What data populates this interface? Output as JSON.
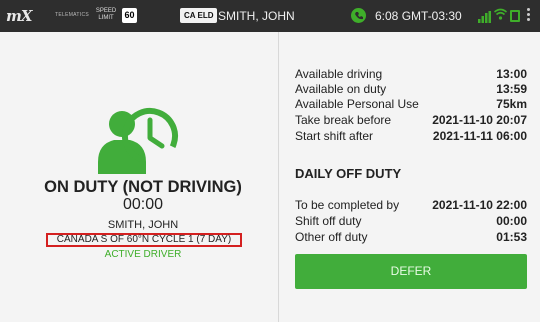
{
  "topbar": {
    "logo": "mX",
    "logo_sub": "TELEMATICS",
    "speed_limit_label": "SPEED LIMIT",
    "speed_limit_value": "60",
    "eld_badge": "CA ELD",
    "driver": "SMITH, JOHN",
    "time": "6:08 GMT-03:30",
    "colors": {
      "background": "#2e2e2e",
      "accent": "#3fae2a"
    },
    "icons": [
      "status-icon",
      "signal-icon",
      "wifi-icon",
      "document-icon",
      "overflow-menu-icon"
    ]
  },
  "status": {
    "duty": "ON DUTY (NOT DRIVING)",
    "time": "00:00",
    "driver": "SMITH, JOHN",
    "cycle": "CANADA S OF 60°N CYCLE 1 (7 DAY)",
    "role": "ACTIVE DRIVER",
    "icon": "driver-clock-icon",
    "colors": {
      "icon": "#41ad3b",
      "highlight_border": "#d42020"
    }
  },
  "availability": [
    {
      "label": "Available driving",
      "value": "13:00"
    },
    {
      "label": "Available on duty",
      "value": "13:59"
    },
    {
      "label": "Available Personal Use",
      "value": "75km"
    },
    {
      "label": "Take break before",
      "value": "2021-11-10 20:07"
    },
    {
      "label": "Start shift after",
      "value": "2021-11-11 06:00"
    }
  ],
  "daily_off_duty": {
    "title": "DAILY OFF DUTY",
    "rows": [
      {
        "label": "To be completed by",
        "value": "2021-11-10 22:00"
      },
      {
        "label": "Shift off duty",
        "value": "00:00"
      },
      {
        "label": "Other off duty",
        "value": "01:53"
      }
    ],
    "button": "DEFER",
    "colors": {
      "button": "#41ad3b"
    }
  }
}
